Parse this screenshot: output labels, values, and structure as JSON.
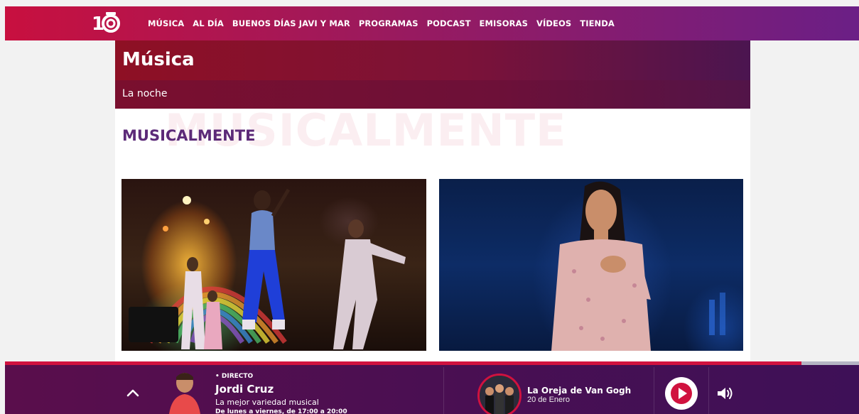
{
  "brand": {
    "logo_text": "100",
    "primary": "#c8103f",
    "secondary": "#6b1f86"
  },
  "nav": {
    "items": [
      "MÚSICA",
      "AL DÍA",
      "BUENOS DÍAS JAVI Y MAR",
      "PROGRAMAS",
      "PODCAST",
      "EMISORAS",
      "VÍDEOS",
      "TIENDA"
    ]
  },
  "section": {
    "title": "Música",
    "subnav": "La noche"
  },
  "page": {
    "watermark": "MUSICALMENTE",
    "heading": "MUSICALMENTE"
  },
  "cards": [
    {
      "image": "concert-stage-photo"
    },
    {
      "image": "singer-portrait-photo"
    }
  ],
  "player": {
    "progress": 0.933,
    "live_label": "• DIRECTO",
    "host_name": "Jordi Cruz",
    "show_desc": "La mejor variedad musical",
    "show_time": "De lunes a viernes, de 17:00 a 20:00",
    "track_title": "La Oreja de Van Gogh",
    "track_sub": "20 de Enero",
    "icons": {
      "expand": "chevron-up-icon",
      "play": "play-icon",
      "volume": "volume-icon"
    }
  }
}
